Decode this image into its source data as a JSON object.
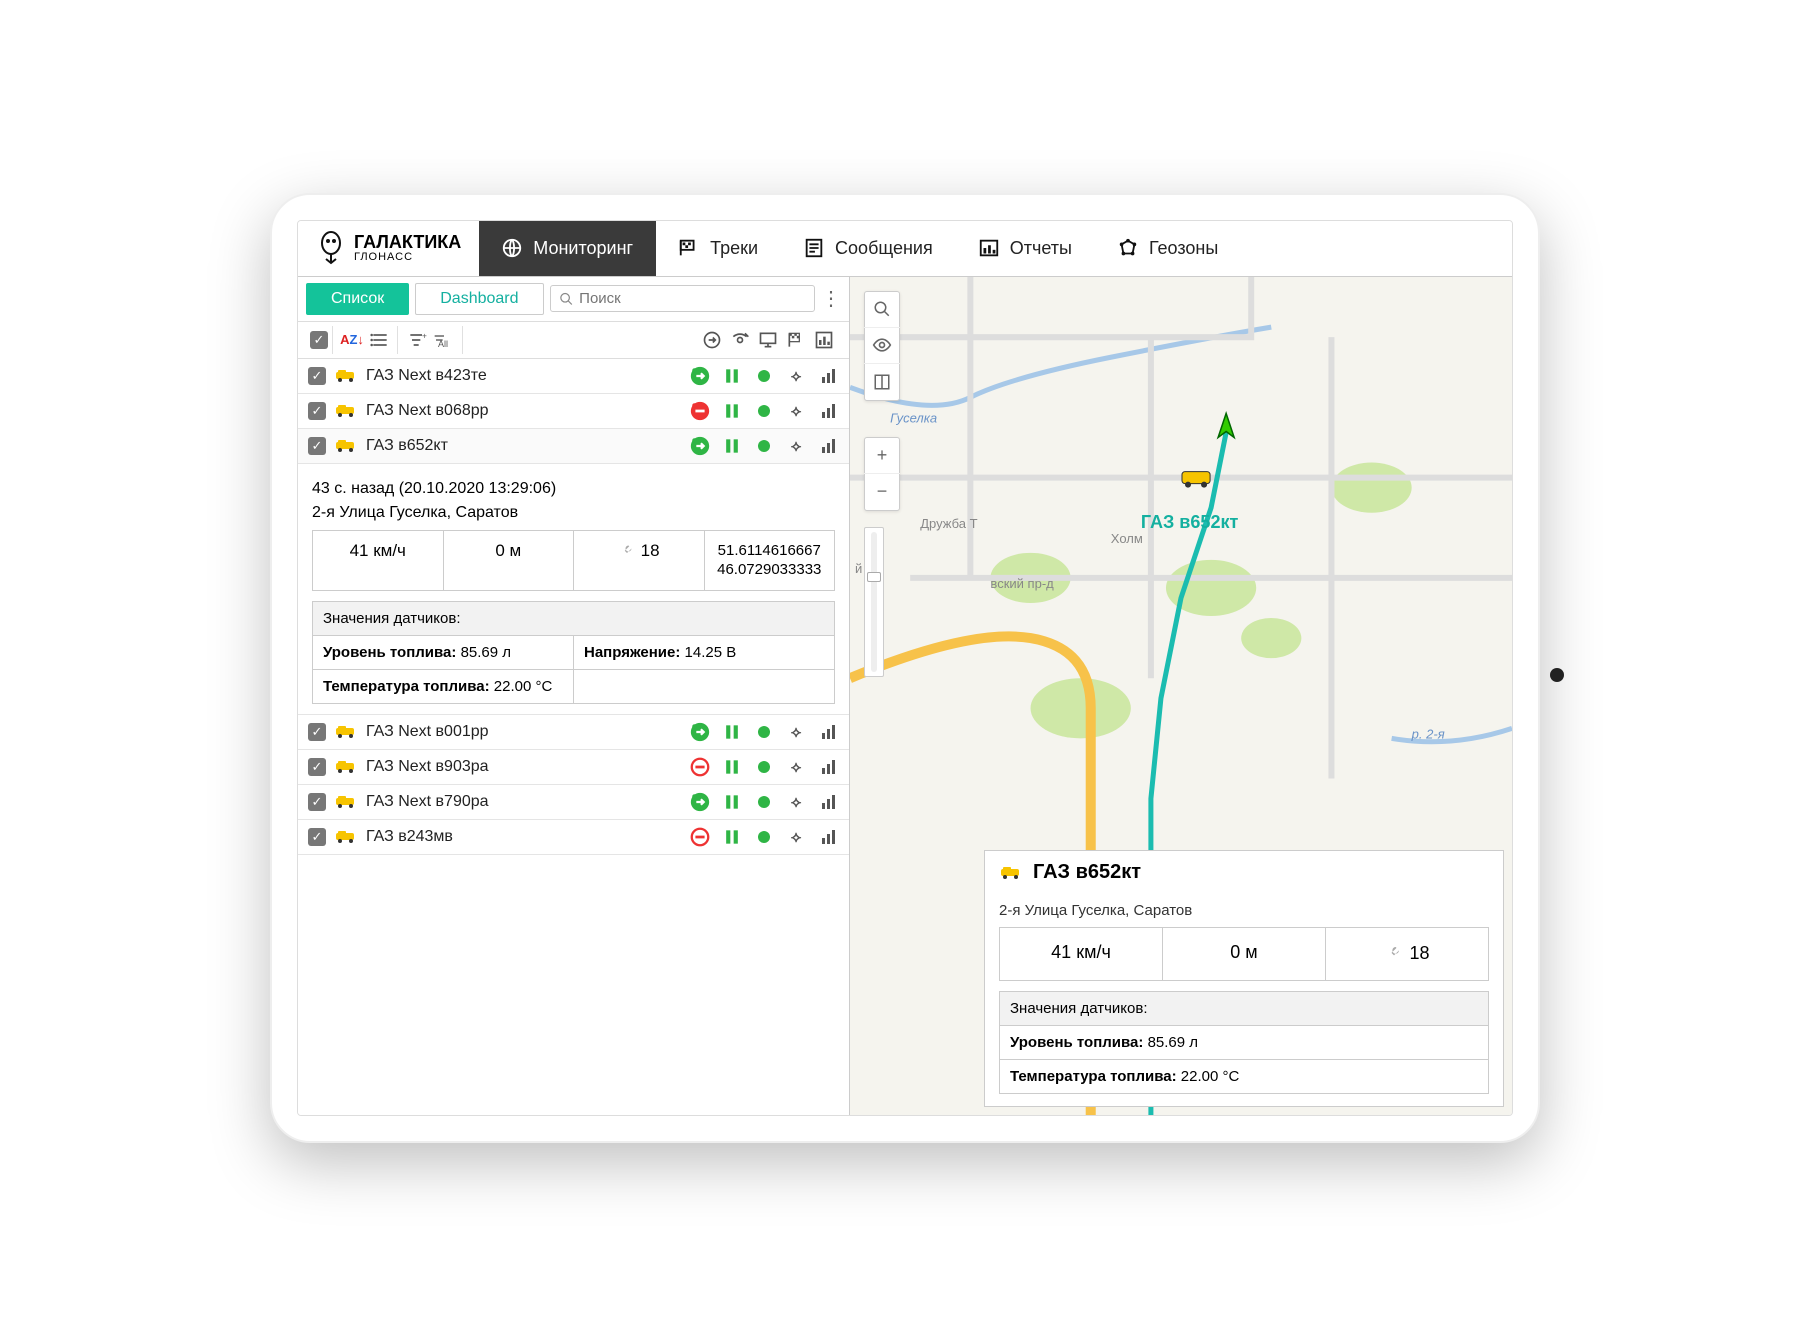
{
  "brand": {
    "name": "ГАЛАКТИКА",
    "sub": "ГЛОНАСС"
  },
  "nav": {
    "monitoring": "Мониторинг",
    "tracks": "Треки",
    "messages": "Сообщения",
    "reports": "Отчеты",
    "geozones": "Геозоны"
  },
  "left": {
    "tab_list": "Список",
    "tab_dashboard": "Dashboard",
    "search_placeholder": "Поиск",
    "sort_all": "All"
  },
  "vehicles": [
    {
      "name": "ГАЗ Next в423те",
      "status": "go-green"
    },
    {
      "name": "ГАЗ Next в068рр",
      "status": "stop-red-fill"
    },
    {
      "name": "ГАЗ в652кт",
      "status": "go-green",
      "selected": true
    },
    {
      "name": "ГАЗ Next в001рр",
      "status": "go-green"
    },
    {
      "name": "ГАЗ Next в903ра",
      "status": "stop-red-outline"
    },
    {
      "name": "ГАЗ Next в790ра",
      "status": "go-green"
    },
    {
      "name": "ГАЗ в243мв",
      "status": "stop-red-outline"
    }
  ],
  "detail": {
    "time_line": "43 с. назад (20.10.2020 13:29:06)",
    "address": "2-я Улица Гуселка, Саратов",
    "speed": "41 км/ч",
    "altitude": "0 м",
    "sat_count": "18",
    "coords_lat": "51.6114616667",
    "coords_lon": "46.0729033333",
    "sensors_header": "Значения датчиков:",
    "fuel_label": "Уровень топлива:",
    "fuel_value": "85.69 л",
    "voltage_label": "Напряжение:",
    "voltage_value": "14.25 В",
    "fuel_temp_label": "Температура топлива:",
    "fuel_temp_value": "22.00 °C"
  },
  "map": {
    "labels": {
      "river_guselka": "Гуселка",
      "druzhba": "Дружба Т",
      "holm": "Холм",
      "proezd": "вский пр-д",
      "g_short": "й Гу",
      "river2": "р. 2-я"
    },
    "vehicle_label": "ГАЗ в652кт"
  },
  "popup": {
    "title": "ГАЗ в652кт",
    "address": "2-я Улица Гуселка, Саратов",
    "speed": "41 км/ч",
    "altitude": "0 м",
    "sat_count": "18",
    "sensors_header": "Значения датчиков:",
    "fuel_label": "Уровень топлива:",
    "fuel_value": "85.69 л",
    "fuel_temp_label": "Температура топлива:",
    "fuel_temp_value": "22.00 °C"
  }
}
